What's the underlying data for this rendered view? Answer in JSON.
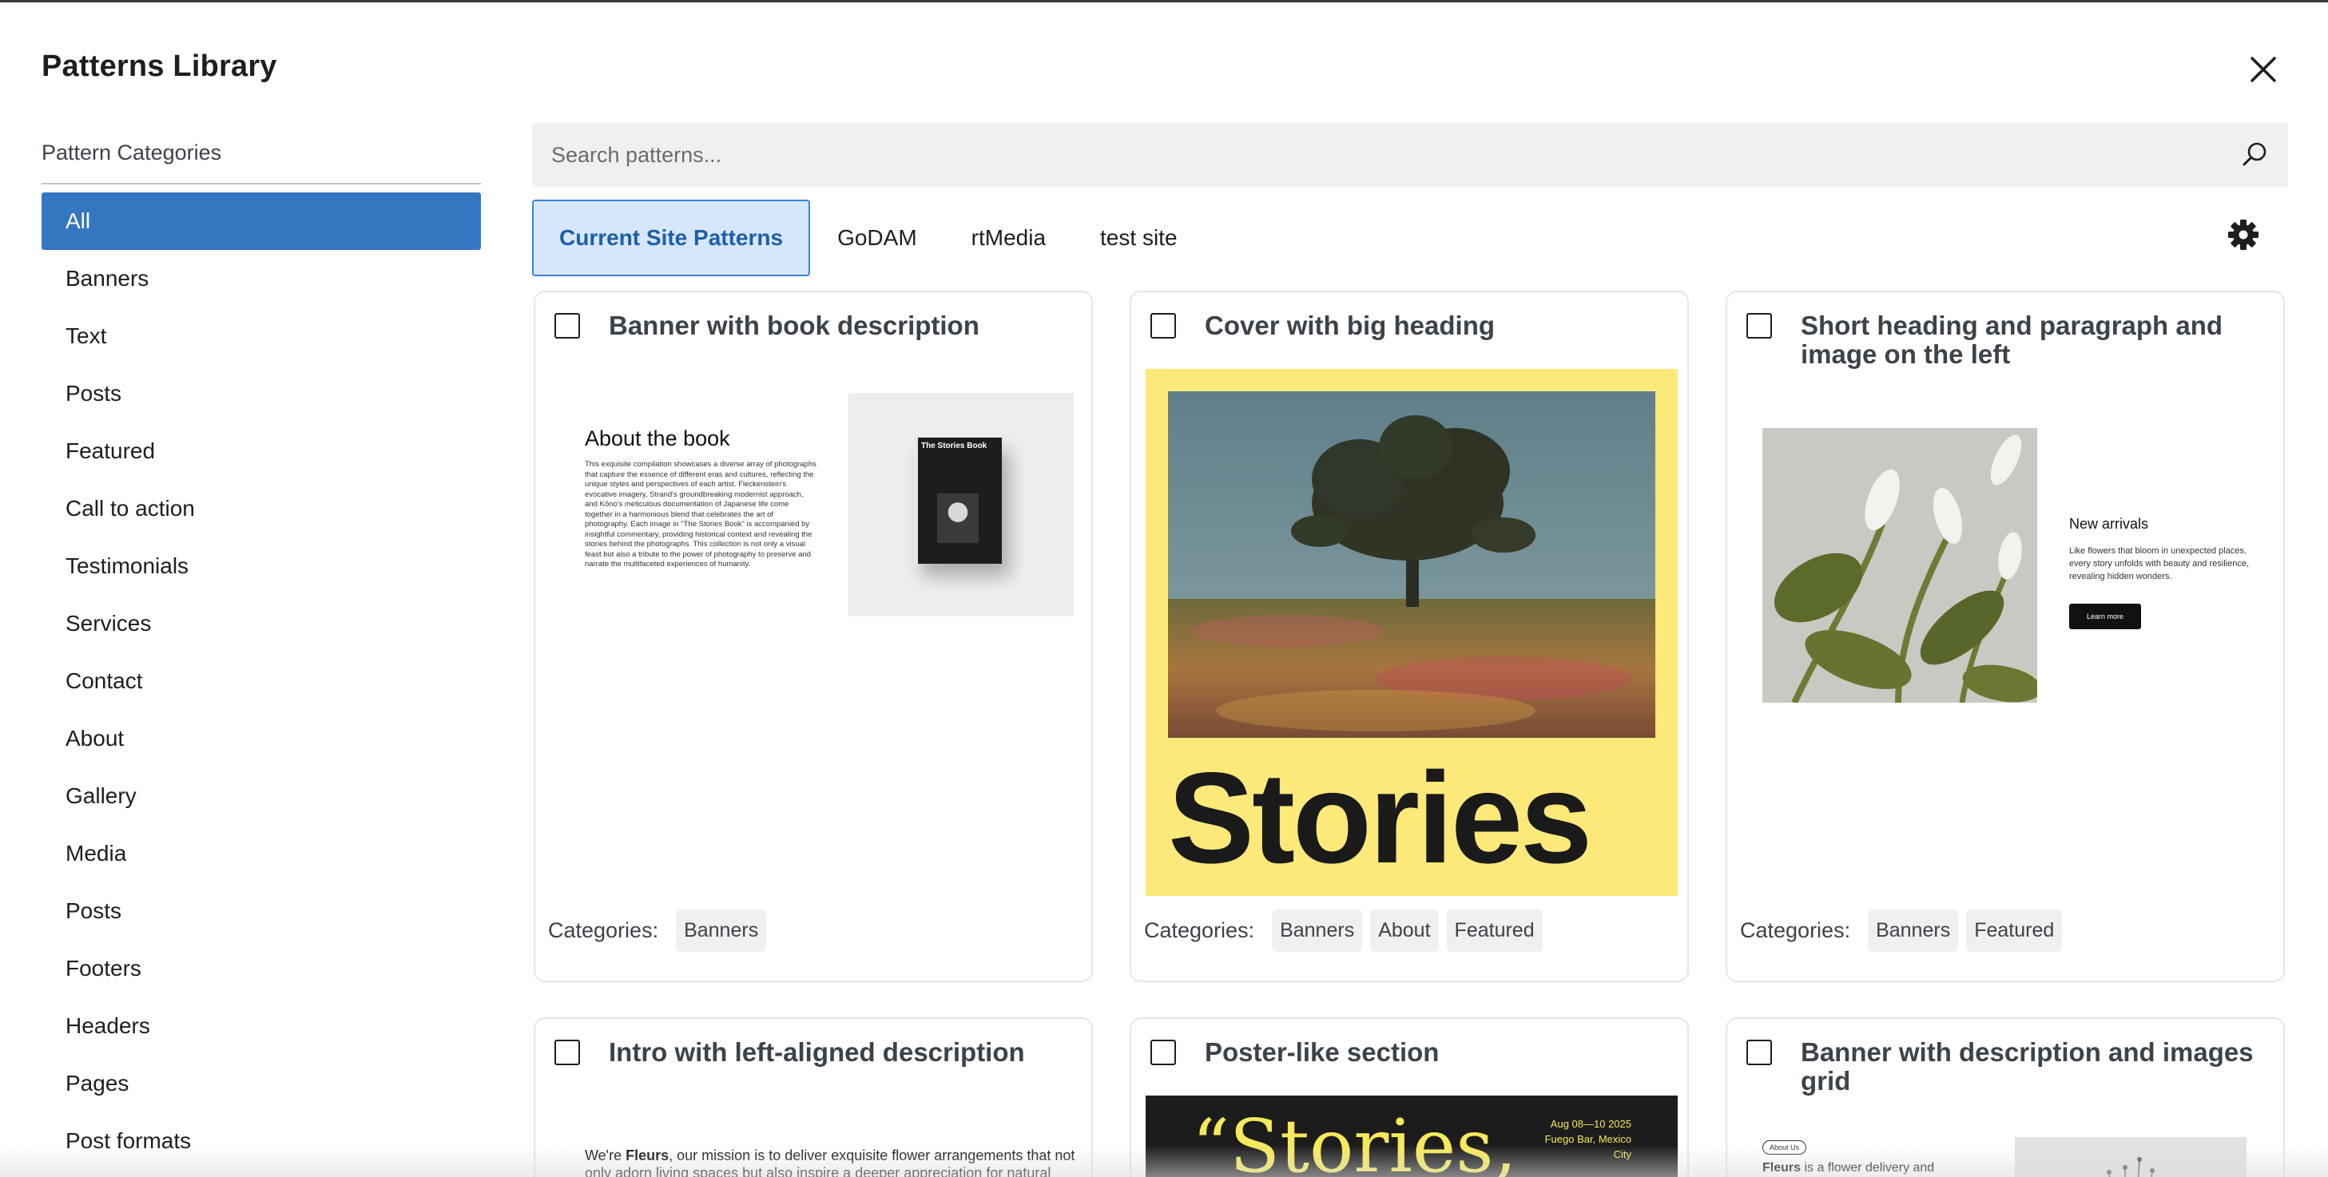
{
  "modal": {
    "title": "Patterns Library"
  },
  "sidebar": {
    "heading": "Pattern Categories",
    "items": [
      {
        "label": "All"
      },
      {
        "label": "Banners"
      },
      {
        "label": "Text"
      },
      {
        "label": "Posts"
      },
      {
        "label": "Featured"
      },
      {
        "label": "Call to action"
      },
      {
        "label": "Testimonials"
      },
      {
        "label": "Services"
      },
      {
        "label": "Contact"
      },
      {
        "label": "About"
      },
      {
        "label": "Gallery"
      },
      {
        "label": "Media"
      },
      {
        "label": "Posts"
      },
      {
        "label": "Footers"
      },
      {
        "label": "Headers"
      },
      {
        "label": "Pages"
      },
      {
        "label": "Post formats"
      }
    ],
    "selected": "All"
  },
  "search": {
    "placeholder": "Search patterns..."
  },
  "tabs": [
    {
      "label": "Current Site Patterns"
    },
    {
      "label": "GoDAM"
    },
    {
      "label": "rtMedia"
    },
    {
      "label": "test site"
    }
  ],
  "active_tab": "Current Site Patterns",
  "categories_label": "Categories:",
  "cards": [
    {
      "title": "Banner with book description",
      "categories": [
        "Banners"
      ],
      "preview": {
        "heading": "About the book",
        "body": "This exquisite compilation showcases a diverse array of photographs that capture the essence of different eras and cultures, reflecting the unique styles and perspectives of each artist. Fleckenstein's evocative imagery, Strand's groundbreaking modernist approach, and Kōno's meticulous documentation of Japanese life come together in a harmonious blend that celebrates the art of photography. Each image in \"The Stories Book\" is accompanied by insightful commentary, providing historical context and revealing the stories behind the photographs. This collection is not only a visual feast but also a tribute to the power of photography to preserve and narrate the multifaceted experiences of humanity.",
        "book_title": "The Stories Book"
      }
    },
    {
      "title": "Cover with big heading",
      "categories": [
        "Banners",
        "About",
        "Featured"
      ],
      "preview": {
        "big_text": "Stories"
      }
    },
    {
      "title": "Short heading and paragraph and image on the left",
      "categories": [
        "Banners",
        "Featured"
      ],
      "preview": {
        "heading": "New arrivals",
        "body": "Like flowers that bloom in unexpected places, every story unfolds with beauty and resilience, revealing hidden wonders.",
        "button": "Learn more"
      }
    },
    {
      "title": "Intro with left-aligned description",
      "preview": {
        "body_prefix": "We're ",
        "body_bold": "Fleurs",
        "body_rest": ", our mission is to deliver exquisite flower arrangements that not only adorn living spaces but also inspire a deeper appreciation for natural"
      }
    },
    {
      "title": "Poster-like section",
      "preview": {
        "big_text": "“Stories,",
        "meta_lines": [
          "Aug 08—10 2025",
          "Fuego Bar, Mexico",
          "City"
        ]
      }
    },
    {
      "title": "Banner with description and images grid",
      "preview": {
        "pill": "About Us",
        "body_bold": "Fleurs",
        "body_rest": " is a flower delivery and subscription"
      }
    }
  ],
  "colors": {
    "accent": "#3576c1",
    "tab_active_bg": "#d6e6fb",
    "cover_yellow": "#fce97a",
    "poster_yellow": "#f6e95a"
  }
}
